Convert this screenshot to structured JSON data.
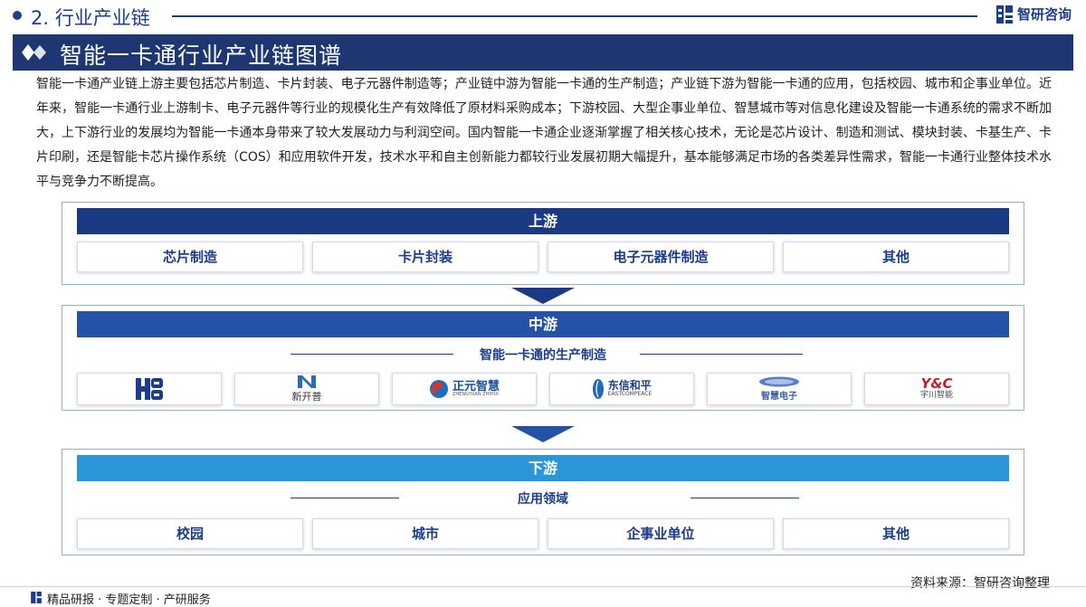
{
  "header": {
    "section_title": "2. 行业产业链",
    "brand": "智研咨询"
  },
  "banner": {
    "title": "智能一卡通行业产业链图谱"
  },
  "intro": {
    "text": "智能一卡通产业链上游主要包括芯片制造、卡片封装、电子元器件制造等；产业链中游为智能一卡通的生产制造；产业链下游为智能一卡通的应用，包括校园、城市和企事业单位。近年来，智能一卡通行业上游制卡、电子元器件等行业的规模化生产有效降低了原材料采购成本；下游校园、大型企事业单位、智慧城市等对信息化建设及智能一卡通系统的需求不断加大，上下游行业的发展均为智能一卡通本身带来了较大发展动力与利润空间。国内智能一卡通企业逐渐掌握了相关核心技术，无论是芯片设计、制造和测试、模块封装、卡基生产、卡片印刷，还是智能卡芯片操作系统（COS）和应用软件开发，技术水平和自主创新能力都较行业发展初期大幅提升，基本能够满足市场的各类差异性需求，智能一卡通行业整体技术水平与竞争力不断提高。"
  },
  "upstream": {
    "label": "上游",
    "items": [
      "芯片制造",
      "卡片封装",
      "电子元器件制造",
      "其他"
    ]
  },
  "midstream": {
    "label": "中游",
    "subtitle": "智能一卡通的生产制造",
    "logos": [
      {
        "icon": "hb-logo-icon",
        "text": ""
      },
      {
        "icon": "xinkaipu-logo-icon",
        "text": "新开普"
      },
      {
        "icon": "zhengyuan-logo-icon",
        "text": "正元智慧",
        "subtext": "ZHENGYUAN ZHIHUI"
      },
      {
        "icon": "dongxinhepin-logo-icon",
        "text": "东信和平",
        "subtext": "EASTCOMPEACE"
      },
      {
        "icon": "zhihui-electronic-logo-icon",
        "text": "智慧电子"
      },
      {
        "icon": "yc-logo-icon",
        "text": "Y&C",
        "subtext": "宇川智能"
      }
    ]
  },
  "downstream": {
    "label": "下游",
    "subtitle": "应用领域",
    "items": [
      "校园",
      "城市",
      "企事业单位",
      "其他"
    ]
  },
  "source": "资料来源：智研咨询整理",
  "footer": {
    "tagline": "精品研报 · 专题定制 · 产研服务"
  },
  "colors": {
    "navy": "#1d3c8a",
    "banner": "#1e3773",
    "upstream_bar": "#1b3a84",
    "midstream_bar": "#2552a6",
    "downstream_bar": "#2b96d8",
    "tier_border": "#8fb0d6"
  }
}
